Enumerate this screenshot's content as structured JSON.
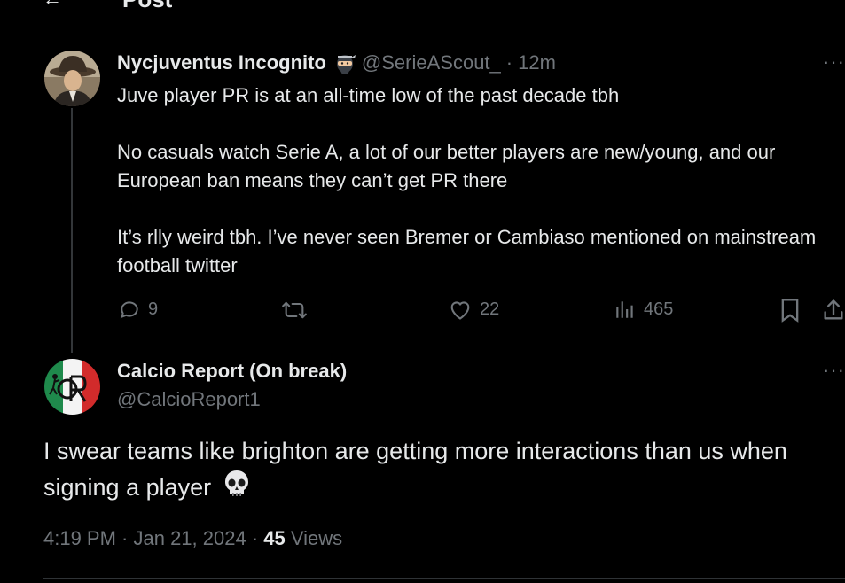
{
  "header": {
    "title": "Post",
    "back_icon": "arrow-left-icon"
  },
  "parent_post": {
    "display_name": "Nycjuventus Incognito",
    "badge_icon": "ninja-emoji-icon",
    "handle": "@SerieAScout_",
    "separator": "·",
    "time": "12m",
    "more_label": "···",
    "paragraphs": [
      "Juve player PR is at an all-time low of the past decade tbh",
      "No casuals watch Serie A, a lot of our better players are new/young, and our European ban means they can’t get PR there",
      "It’s rlly weird tbh. I’ve never seen Bremer or Cambiaso mentioned on mainstream football twitter"
    ],
    "actions": {
      "replies": "9",
      "reposts": "",
      "likes": "22",
      "views": "465"
    }
  },
  "main_post": {
    "display_name": "Calcio Report (On break)",
    "handle": "@CalcioReport1",
    "more_label": "···",
    "text": "I swear teams like brighton are getting more interactions than us when signing a player",
    "emoji_icon": "skull-emoji-icon",
    "timestamp": "4:19 PM · Jan 21, 2024 ·",
    "views_count": "45",
    "views_label": "Views"
  },
  "colors": {
    "background": "#000000",
    "text_primary": "#e7e9ea",
    "text_secondary": "#71767b",
    "divider": "#2f3336"
  }
}
